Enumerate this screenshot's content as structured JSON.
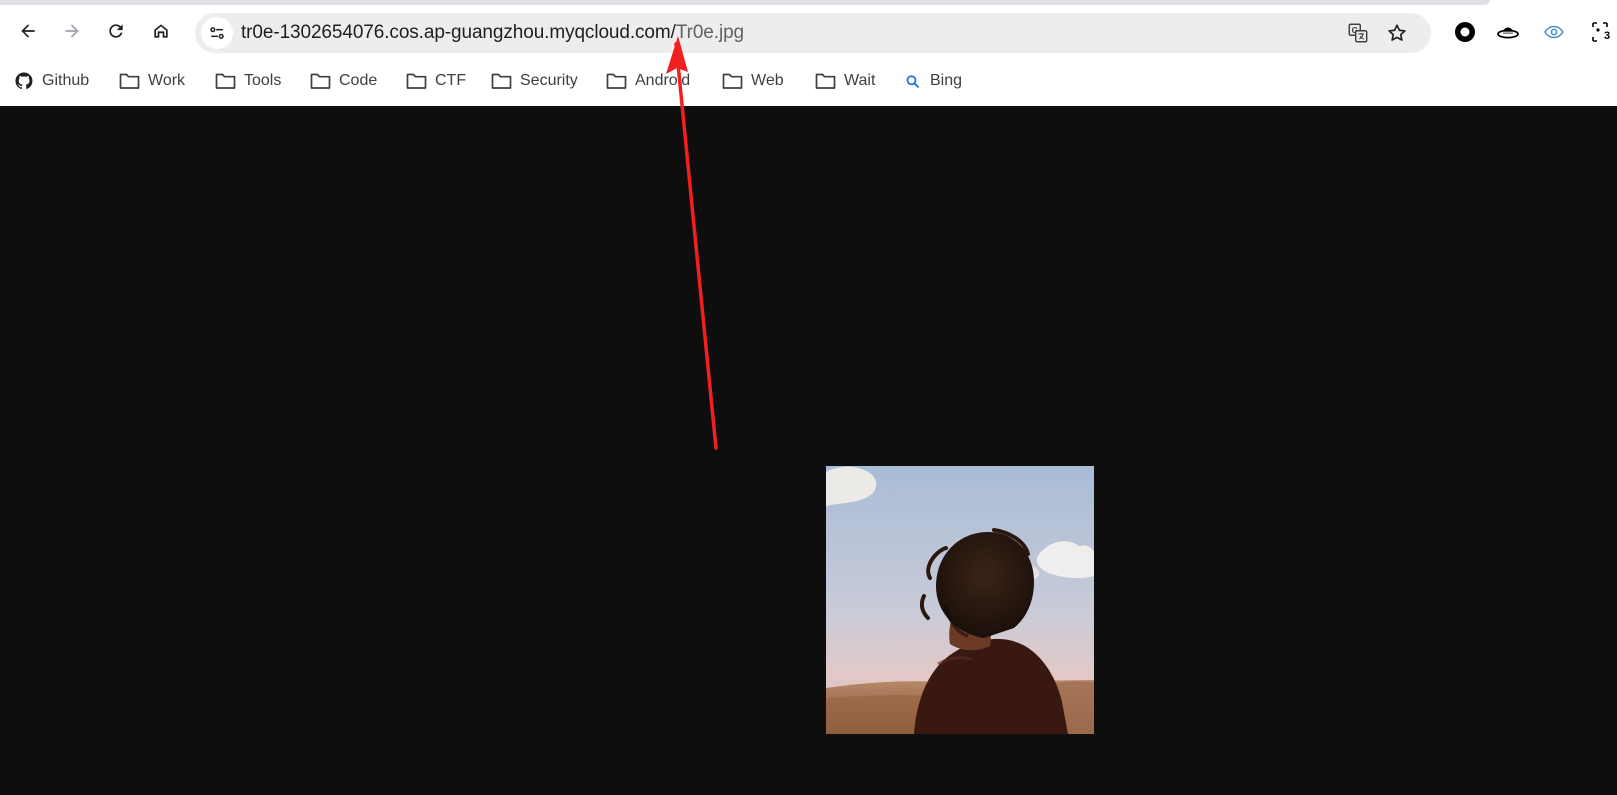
{
  "browser": {
    "url": {
      "host": "tr0e-1302654076.cos.ap-guangzhou.myqcloud.com/",
      "path": "Tr0e.jpg"
    },
    "nav": {
      "back_icon": "arrow-left-icon",
      "forward_icon": "arrow-right-icon",
      "reload_icon": "reload-icon",
      "home_icon": "home-icon"
    },
    "omnibox_icons": [
      "site-info-icon",
      "translate-icon",
      "star-icon"
    ],
    "extensions": [
      {
        "icon": "record-circle-icon"
      },
      {
        "icon": "hat-icon"
      },
      {
        "icon": "eye-icon"
      },
      {
        "icon": "screenshot-icon",
        "badge": "3"
      }
    ]
  },
  "bookmarks": [
    {
      "label": "Github",
      "icon": "github-icon"
    },
    {
      "label": "Work",
      "icon": "folder-icon"
    },
    {
      "label": "Tools",
      "icon": "folder-icon"
    },
    {
      "label": "Code",
      "icon": "folder-icon"
    },
    {
      "label": "CTF",
      "icon": "folder-icon"
    },
    {
      "label": "Security",
      "icon": "folder-icon"
    },
    {
      "label": "Android",
      "icon": "folder-icon"
    },
    {
      "label": "Web",
      "icon": "folder-icon"
    },
    {
      "label": "Wait",
      "icon": "folder-icon"
    },
    {
      "label": "Bing",
      "icon": "search-icon"
    }
  ],
  "content": {
    "image_subject": "photo-boy-looking-away",
    "annotation": "red-arrow-pointing-to-filename"
  },
  "colors": {
    "page_background": "#0e0e0e",
    "omnibox_background": "#eeeded",
    "annotation_red": "#f21f1f",
    "bing_accent": "#1a73e8"
  }
}
